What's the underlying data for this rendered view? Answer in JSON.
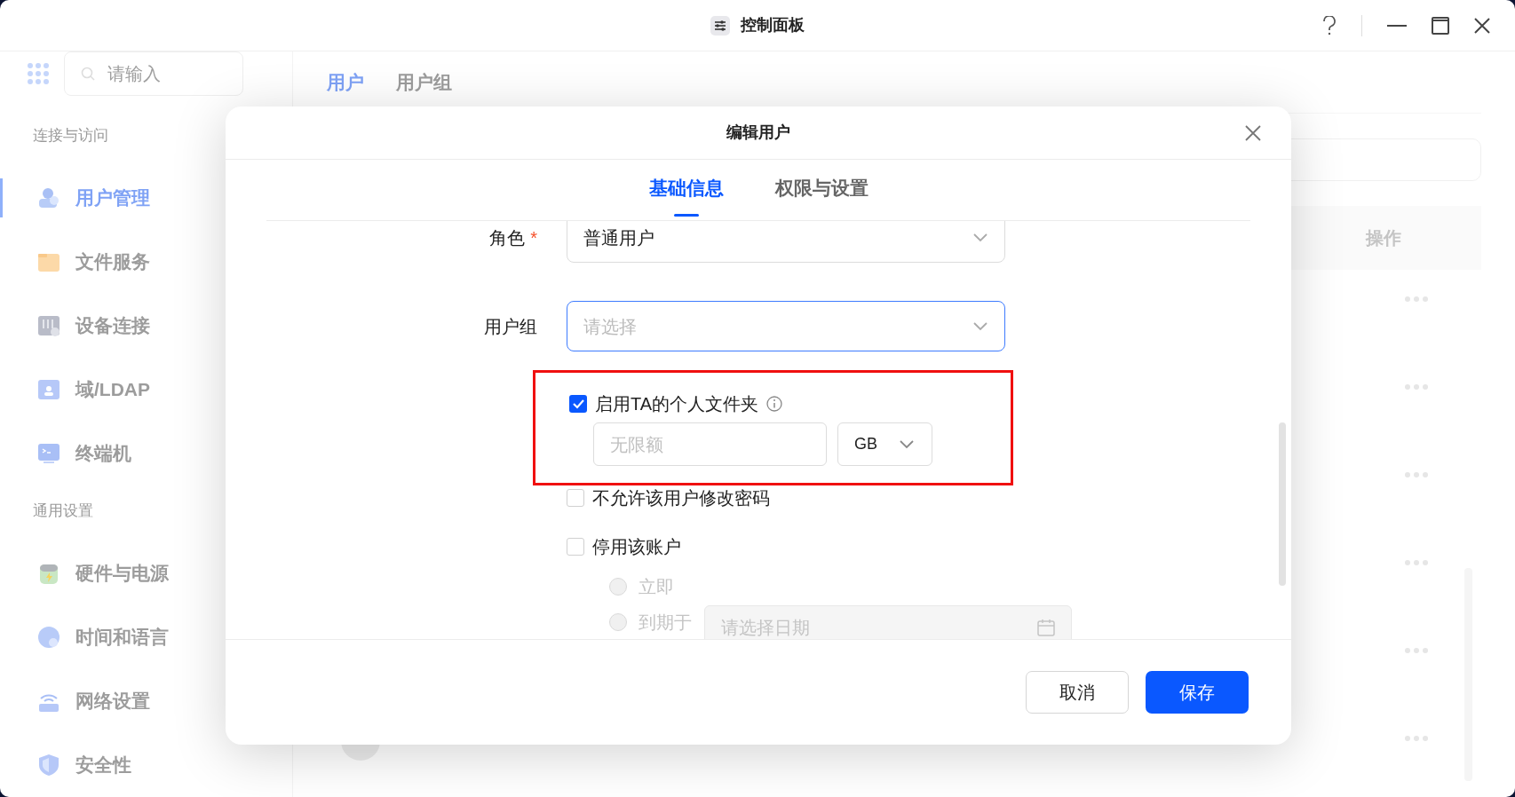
{
  "window": {
    "title": "控制面板"
  },
  "sidebar": {
    "search_placeholder": "请输入",
    "sections": [
      {
        "label": "连接与访问",
        "items": [
          {
            "label": "用户管理",
            "selected": true
          },
          {
            "label": "文件服务",
            "selected": false
          },
          {
            "label": "设备连接",
            "selected": false
          },
          {
            "label": "域/LDAP",
            "selected": false
          },
          {
            "label": "终端机",
            "selected": false
          }
        ]
      },
      {
        "label": "通用设置",
        "items": [
          {
            "label": "硬件与电源",
            "selected": false
          },
          {
            "label": "时间和语言",
            "selected": false
          },
          {
            "label": "网络设置",
            "selected": false
          },
          {
            "label": "安全性",
            "selected": false
          }
        ]
      }
    ]
  },
  "main": {
    "tabs": [
      {
        "label": "用户",
        "selected": true
      },
      {
        "label": "用户组",
        "selected": false
      }
    ],
    "table": {
      "columns": [
        "操作"
      ]
    }
  },
  "dialog": {
    "title": "编辑用户",
    "tabs": [
      {
        "label": "基础信息",
        "selected": true
      },
      {
        "label": "权限与设置",
        "selected": false
      }
    ],
    "fields": [
      {
        "label": "角色",
        "required_mark": "*",
        "value": "普通用户",
        "focused": false
      },
      {
        "label": "用户组",
        "placeholder": "请选择",
        "focused": true
      }
    ],
    "personal_folder": {
      "label": "启用TA的个人文件夹",
      "checked": true,
      "highlighted": true,
      "quota_placeholder": "无限额",
      "unit": "GB"
    },
    "options": [
      {
        "label": "不允许该用户修改密码",
        "checked": false
      },
      {
        "label": "停用该账户",
        "checked": false
      }
    ],
    "disable_timing": [
      {
        "label": "立即",
        "selected": false,
        "disabled": true
      },
      {
        "label": "到期于",
        "selected": false,
        "disabled": true
      }
    ],
    "date_placeholder": "请选择日期",
    "buttons": [
      {
        "label": "取消",
        "kind": "secondary"
      },
      {
        "label": "保存",
        "kind": "primary"
      }
    ]
  }
}
